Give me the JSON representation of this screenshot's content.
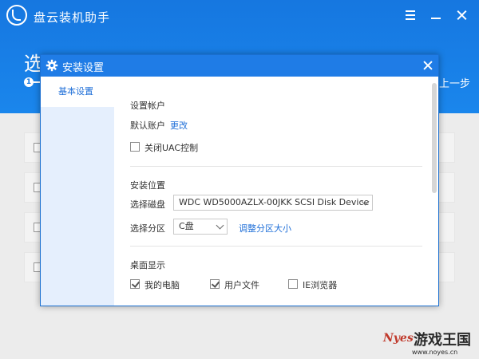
{
  "app": {
    "title": "盘云装机助手",
    "heading_partial": "选",
    "step_number": "1",
    "back_label": "上一步"
  },
  "dialog": {
    "title": "安装设置",
    "nav": [
      {
        "label": "基本设置"
      }
    ],
    "account": {
      "section_title": "设置帐户",
      "default_account_label": "默认账户",
      "change_link": "更改",
      "disable_uac_label": "关闭UAC控制",
      "disable_uac_checked": false
    },
    "install_location": {
      "section_title": "安装位置",
      "disk_label": "选择磁盘",
      "disk_value": "WDC WD5000AZLX-00JKK SCSI Disk Device",
      "partition_label": "选择分区",
      "partition_value": "C盘",
      "resize_link": "调整分区大小"
    },
    "desktop": {
      "section_title": "桌面显示",
      "items": [
        {
          "label": "我的电脑",
          "checked": true
        },
        {
          "label": "用户文件",
          "checked": true
        },
        {
          "label": "IE浏览器",
          "checked": false
        }
      ]
    }
  },
  "watermark": {
    "logo": "Nyes",
    "text": "游戏王国",
    "url": "www.noyes.cn"
  },
  "colors": {
    "header_blue": "#1677e0",
    "dialog_title_blue": "#1f7ce6",
    "link_blue": "#1f6fd8",
    "nav_bg": "#e5effd"
  }
}
